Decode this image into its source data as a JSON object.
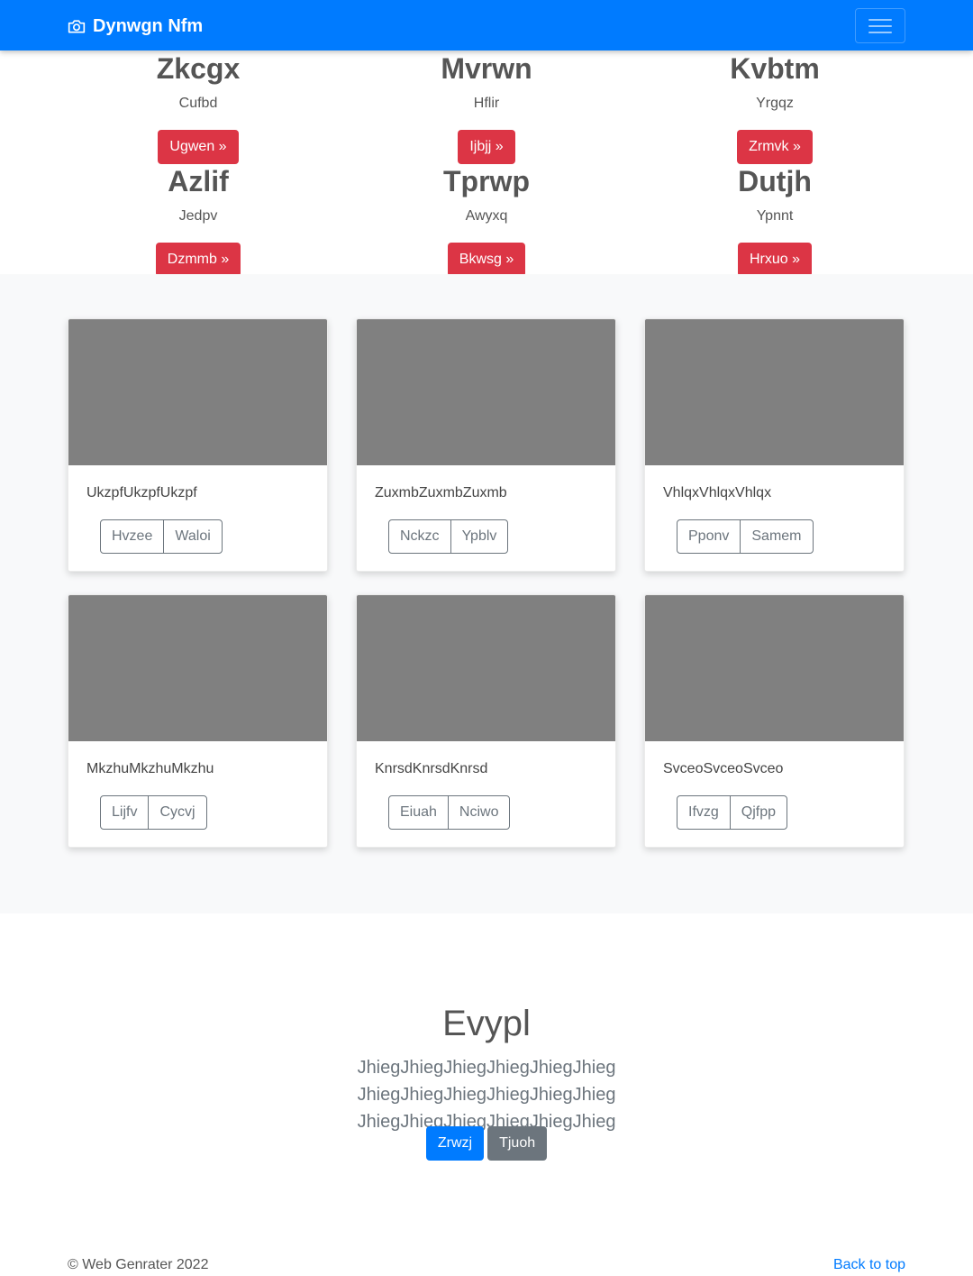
{
  "navbar": {
    "brand": "Dynwgn Nfm",
    "brand_icon": "camera-icon",
    "toggle_icon": "hamburger-menu-icon",
    "color": "#007bff"
  },
  "features": [
    {
      "title": "Zkcgx",
      "text": "Cufbd",
      "button": "Ugwen »"
    },
    {
      "title": "Mvrwn",
      "text": "Hflir",
      "button": "Ijbjj »"
    },
    {
      "title": "Kvbtm",
      "text": "Yrgqz",
      "button": "Zrmvk »"
    },
    {
      "title": "Azlif",
      "text": "Jedpv",
      "button": "Dzmmb »"
    },
    {
      "title": "Tprwp",
      "text": "Awyxq",
      "button": "Bkwsg »"
    },
    {
      "title": "Dutjh",
      "text": "Ypnnt",
      "button": "Hrxuo »"
    }
  ],
  "cards": [
    {
      "text": "UkzpfUkzpfUkzpf",
      "btn1": "Hvzee",
      "btn2": "Waloi"
    },
    {
      "text": "ZuxmbZuxmbZuxmb",
      "btn1": "Nckzc",
      "btn2": "Ypblv"
    },
    {
      "text": "VhlqxVhlqxVhlqx",
      "btn1": "Pponv",
      "btn2": "Samem"
    },
    {
      "text": "MkzhuMkzhuMkzhu",
      "btn1": "Lijfv",
      "btn2": "Cycvj"
    },
    {
      "text": "KnrsdKnrsdKnrsd",
      "btn1": "Eiuah",
      "btn2": "Nciwo"
    },
    {
      "text": "SvceoSvceoSvceo",
      "btn1": "Ifvzg",
      "btn2": "Qjfpp"
    }
  ],
  "jumbotron": {
    "title": "Evypl",
    "lead": "JhiegJhiegJhiegJhiegJhiegJhieg JhiegJhiegJhiegJhiegJhiegJhieg JhiegJhiegJhiegJhiegJhiegJhieg",
    "primary_button": "Zrwzj",
    "secondary_button": "Tjuoh"
  },
  "footer": {
    "copyright": "© Web Genrater 2022",
    "back_to_top": "Back to top"
  },
  "colors": {
    "primary": "#007bff",
    "danger": "#dc3545",
    "secondary": "#6c757d",
    "placeholder": "#808080"
  }
}
